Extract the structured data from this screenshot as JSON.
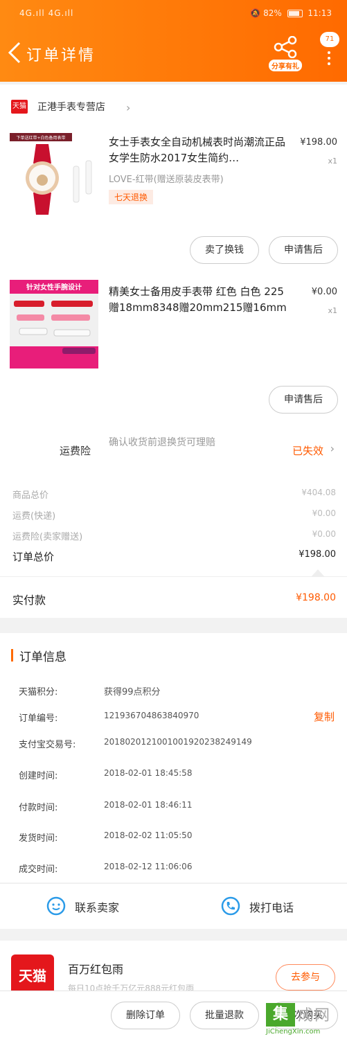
{
  "status_bar": {
    "signal": "4G.ıll 4G.ıll",
    "battery": "82%",
    "time": "11:13"
  },
  "header": {
    "title": "订单详情",
    "share_label": "分享有礼",
    "bubble": "71"
  },
  "store": {
    "badge": "天猫",
    "name": "正港手表专营店"
  },
  "products": [
    {
      "name": "女士手表女全自动机械表时尚潮流正品女学生防水2017女生简约…",
      "price": "¥198.00",
      "qty": "x1",
      "sku": "LOVE-红带(赠送原装皮表带)",
      "tag": "七天退换",
      "img_banner": "下单送红带+白色备用表带",
      "buttons": [
        "卖了换钱",
        "申请售后"
      ]
    },
    {
      "name": "精美女士备用皮手表带 红色 白色 225赠18mm8348赠20mm215赠16mm",
      "price": "¥0.00",
      "qty": "x1",
      "img_banner": "针对女性手腕设计",
      "buttons": [
        "申请售后"
      ]
    }
  ],
  "freight_insurance": {
    "label": "运费险",
    "desc": "确认收货前退换货可理赔",
    "status": "已失效"
  },
  "summary": {
    "rows": [
      {
        "label": "商品总价",
        "value": "¥404.08"
      },
      {
        "label": "运费(快递)",
        "value": "¥0.00"
      },
      {
        "label": "运费险(卖家赠送)",
        "value": "¥0.00"
      }
    ],
    "total_label": "订单总价",
    "total_value": "¥198.00",
    "paid_label": "实付款",
    "paid_value": "¥198.00"
  },
  "order_info": {
    "title": "订单信息",
    "copy_label": "复制",
    "rows": [
      {
        "label": "天猫积分:",
        "value": "获得99点积分"
      },
      {
        "label": "订单编号:",
        "value": "121936704863840970"
      },
      {
        "label": "支付宝交易号:",
        "value": "2018020121001001920238249149"
      },
      {
        "label": "创建时间:",
        "value": "2018-02-01 18:45:58"
      },
      {
        "label": "付款时间:",
        "value": "2018-02-01 18:46:11"
      },
      {
        "label": "发货时间:",
        "value": "2018-02-02 11:05:50"
      },
      {
        "label": "成交时间:",
        "value": "2018-02-12 11:06:06"
      }
    ]
  },
  "contact": {
    "chat": "联系卖家",
    "phone": "拨打电话"
  },
  "promo": {
    "logo": "天猫",
    "title": "百万红包雨",
    "subtitle": "每日10点抢千万亿元888元红包雨",
    "button": "去参与"
  },
  "bottom_actions": [
    "删除订单",
    "批量退款",
    "再次购买"
  ],
  "watermark": {
    "char": "集",
    "text": "成网",
    "url": "JiChengXin.com"
  },
  "colors": {
    "brand_orange": "#ff6a00",
    "tmall_red": "#e4171c",
    "accent_text": "#ff5a00"
  }
}
